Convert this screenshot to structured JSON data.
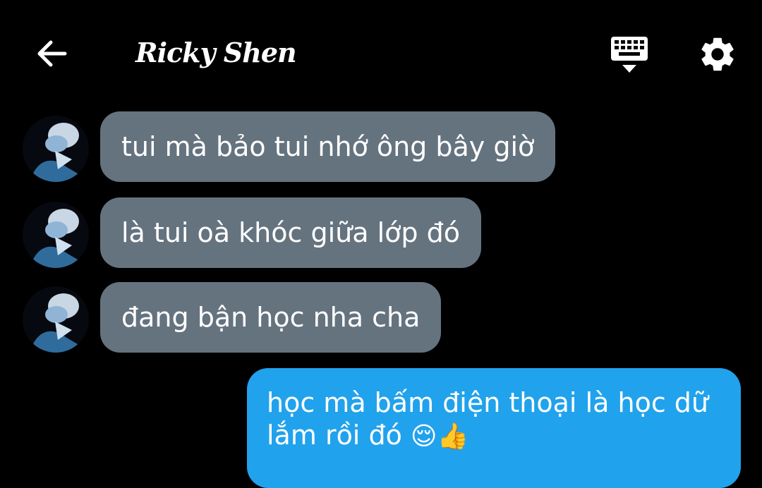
{
  "header": {
    "title": "Ricky Shen",
    "back_icon": "arrow-left-icon",
    "keyboard_icon": "keyboard-hide-icon",
    "settings_icon": "gear-icon"
  },
  "messages": [
    {
      "direction": "incoming",
      "text": "tui mà bảo tui nhớ ông bây giờ"
    },
    {
      "direction": "incoming",
      "text": "là tui oà khóc giữa lớp đó"
    },
    {
      "direction": "incoming",
      "text": "đang bận học nha cha"
    },
    {
      "direction": "outgoing",
      "text": "học mà bấm điện thoại là học dữ lắm rồi đó",
      "emojis": "😌👍"
    }
  ],
  "colors": {
    "background": "#000000",
    "incoming_bubble": "#65737f",
    "outgoing_bubble": "#21a2ec",
    "text": "#ffffff"
  }
}
